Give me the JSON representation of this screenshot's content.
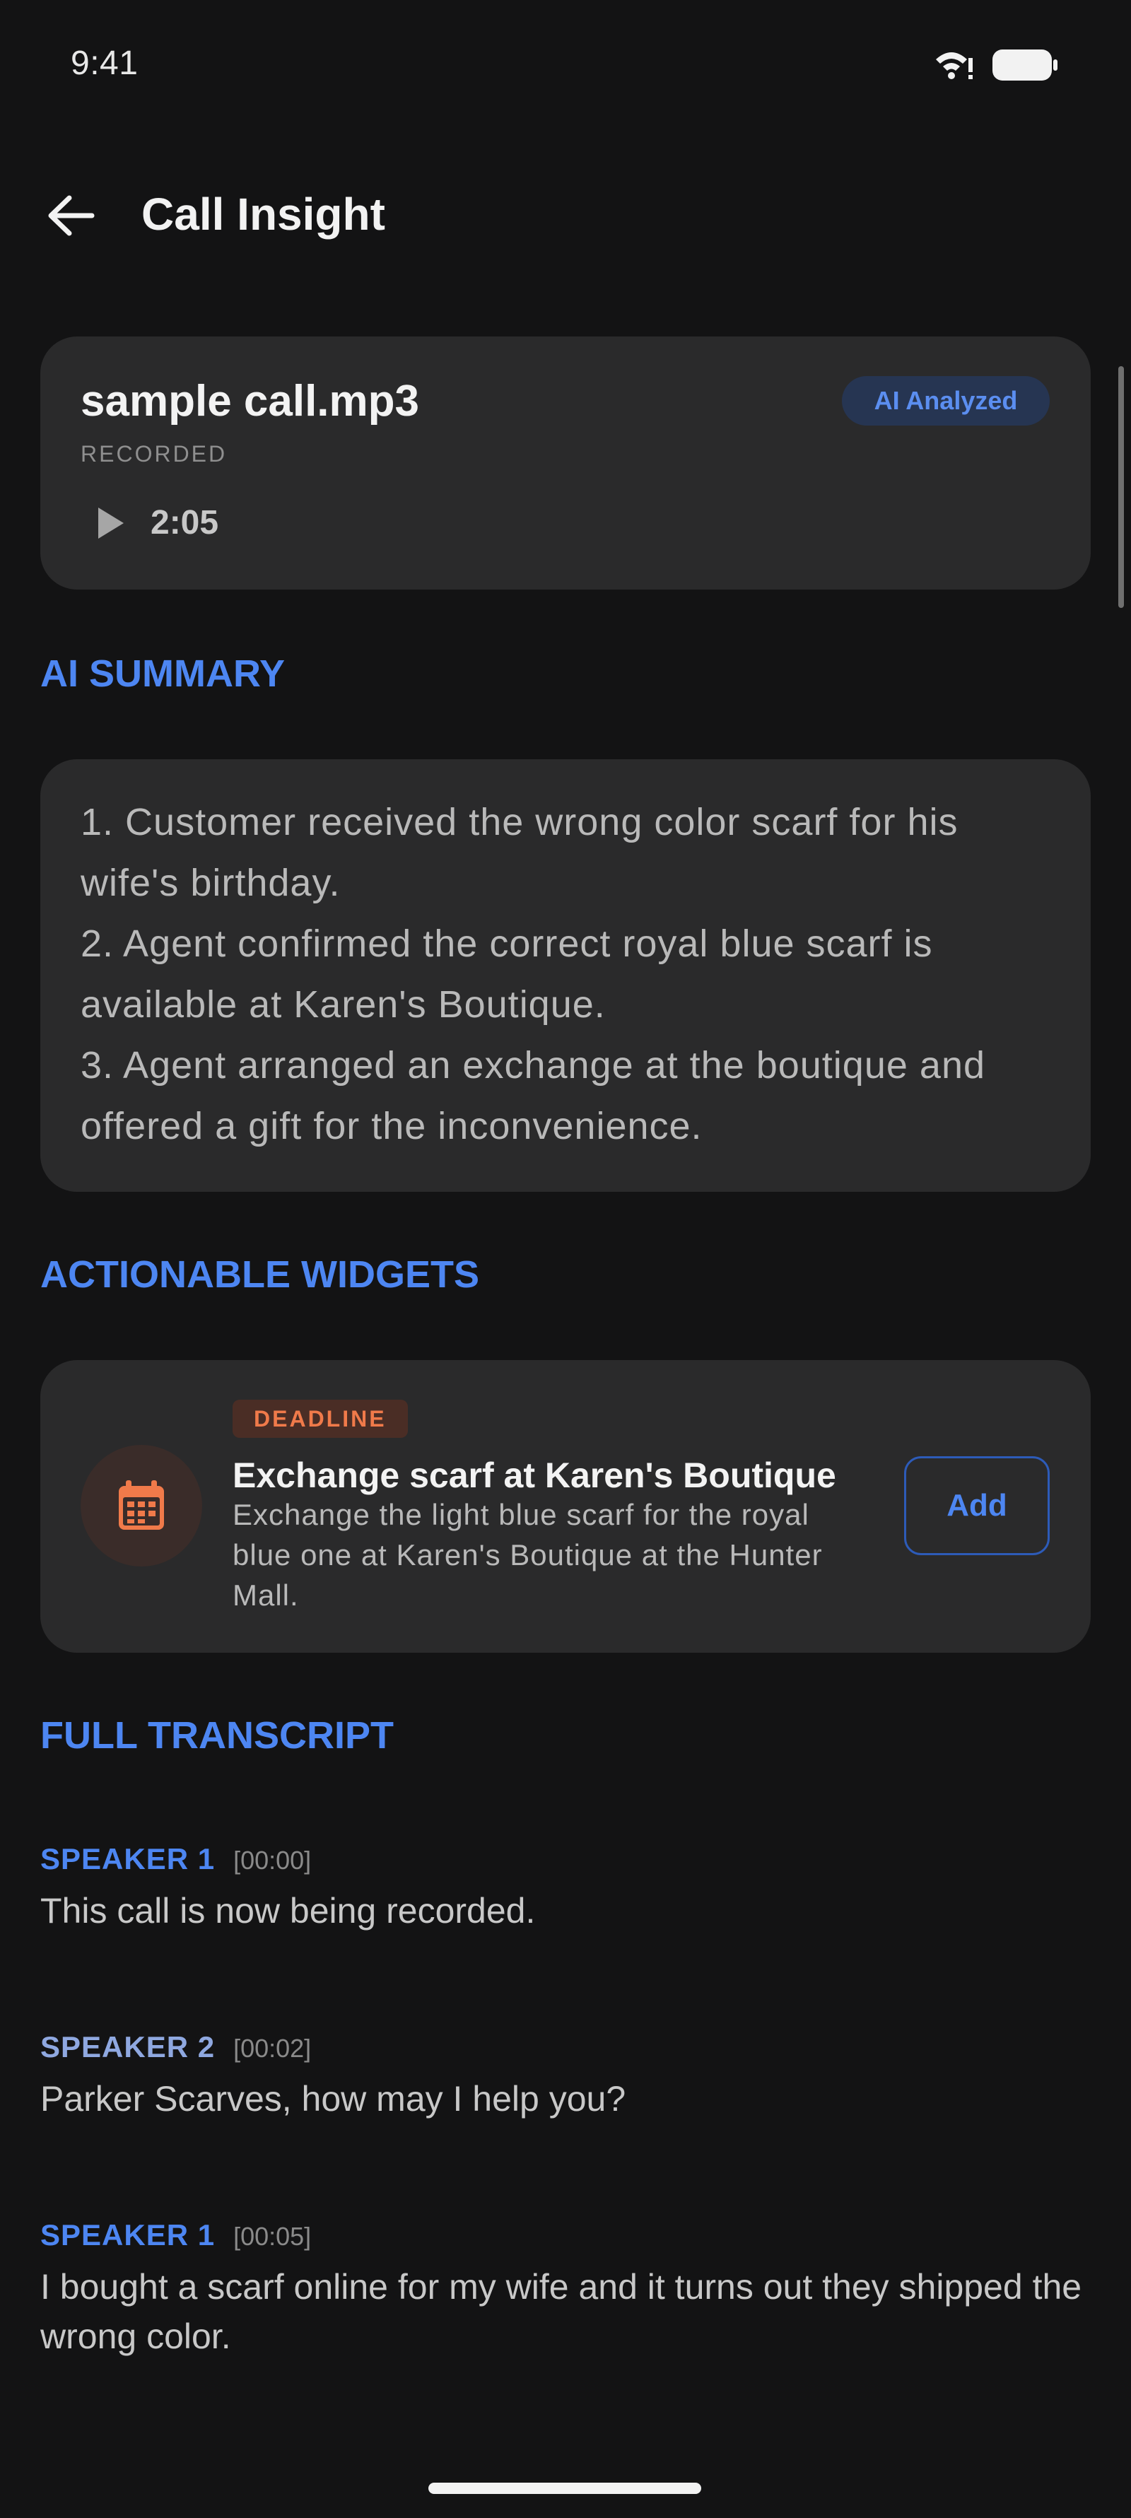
{
  "status_bar": {
    "time": "9:41"
  },
  "app_bar": {
    "title": "Call Insight"
  },
  "recording": {
    "file_name": "sample call.mp3",
    "label": "RECORDED",
    "badge": "AI Analyzed",
    "duration": "2:05"
  },
  "sections": {
    "summary": "AI SUMMARY",
    "widgets": "ACTIONABLE WIDGETS",
    "transcript": "FULL TRANSCRIPT"
  },
  "summary": {
    "items": [
      "1. Customer received the wrong color scarf for his wife's birthday.",
      "2. Agent confirmed the correct royal blue scarf is available at Karen's Boutique.",
      "3. Agent arranged an exchange at the boutique and offered a gift for the inconvenience."
    ]
  },
  "widget": {
    "badge": "DEADLINE",
    "title": "Exchange scarf at Karen's Boutique",
    "description": "Exchange the light blue scarf for the royal blue one at Karen's Boutique at the Hunter Mall.",
    "button": "Add",
    "icon": "calendar-icon"
  },
  "transcript": [
    {
      "speaker": "SPEAKER 1",
      "time": "[00:00]",
      "text": "This call is now being recorded."
    },
    {
      "speaker": "SPEAKER 2",
      "time": "[00:02]",
      "text": "Parker Scarves, how may I help you?"
    },
    {
      "speaker": "SPEAKER 1",
      "time": "[00:05]",
      "text": "I bought a scarf online for my wife and it turns out they shipped the wrong color."
    }
  ],
  "colors": {
    "background": "#131314",
    "card": "#2a2a2b",
    "accent": "#4d86f2",
    "deadline": "#f07a4a"
  }
}
